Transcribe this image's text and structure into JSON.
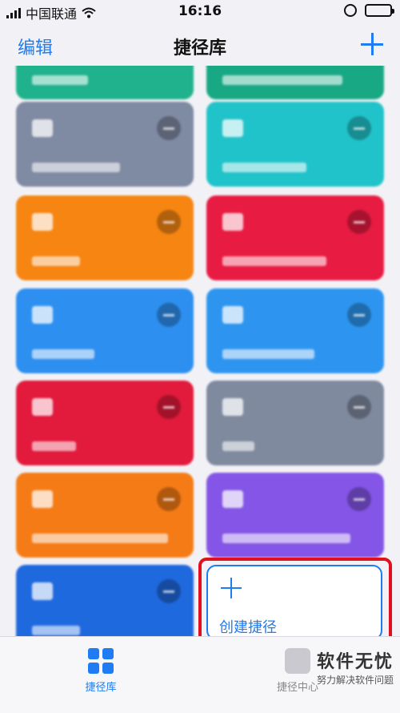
{
  "status_bar": {
    "carrier": "中国联通",
    "time": "16:16"
  },
  "nav": {
    "edit_label": "编辑",
    "title": "捷径库",
    "add_icon": "plus-icon"
  },
  "cards": [
    {
      "color": "#20b28c"
    },
    {
      "color": "#19a884"
    },
    {
      "color": "#7f8aa3"
    },
    {
      "color": "#20c3c9"
    },
    {
      "color": "#f68512"
    },
    {
      "color": "#e81b42"
    },
    {
      "color": "#2d8ff0"
    },
    {
      "color": "#2d95ef"
    },
    {
      "color": "#e21a3c"
    },
    {
      "color": "#7f8a9f"
    },
    {
      "color": "#f57b16"
    },
    {
      "color": "#8455e6"
    },
    {
      "color": "#1f69de"
    }
  ],
  "create_card": {
    "label": "创建捷径",
    "icon": "plus-icon"
  },
  "tabs": [
    {
      "label": "捷径库",
      "icon": "grid-icon",
      "active": true
    },
    {
      "label": "捷径中心",
      "icon": "gallery-icon",
      "active": false
    }
  ],
  "watermark": {
    "title": "软件无忧",
    "subtitle": "努力解决软件问题"
  }
}
